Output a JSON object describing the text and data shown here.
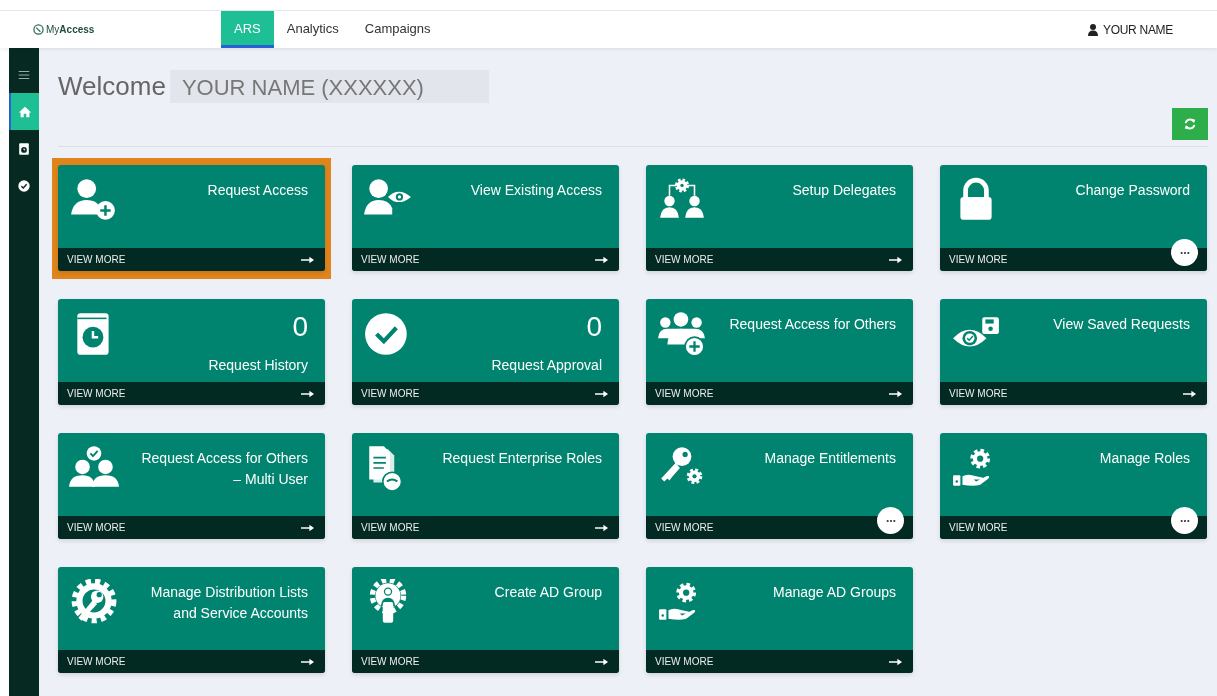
{
  "header": {
    "logo": "My**Access**",
    "tabs": [
      {
        "label": "ARS",
        "selected": true
      },
      {
        "label": "Analytics",
        "selected": false
      },
      {
        "label": "Campaigns",
        "selected": false
      }
    ],
    "user": "YOUR NAME"
  },
  "sidebar": {
    "items": [
      {
        "kind": "menu",
        "selected": false
      },
      {
        "kind": "home",
        "selected": true
      },
      {
        "kind": "history",
        "selected": false
      },
      {
        "kind": "check",
        "selected": false
      }
    ]
  },
  "welcome": {
    "label": "Welcome",
    "name": "YOUR NAME (XXXXXX)"
  },
  "cards": [
    {
      "title": "Request Access",
      "kind": "user-plus",
      "footer": {
        "label": "VIEW MORE",
        "kind": "arrow"
      },
      "highlighted": true
    },
    {
      "title": "View Existing Access",
      "kind": "user-eye",
      "footer": {
        "label": "VIEW MORE",
        "kind": "arrow"
      },
      "highlighted": false
    },
    {
      "title": "Setup Delegates",
      "kind": "delegates",
      "footer": {
        "label": "VIEW MORE",
        "kind": "arrow"
      },
      "highlighted": false
    },
    {
      "title": "Change Password",
      "kind": "lock",
      "footer": {
        "label": "VIEW MORE",
        "kind": "more"
      },
      "highlighted": false
    },
    {
      "title": "Request History",
      "count": "0",
      "kind": "history",
      "footer": {
        "label": "VIEW MORE",
        "kind": "arrow"
      },
      "highlighted": false
    },
    {
      "title": "Request Approval",
      "count": "0",
      "kind": "check",
      "footer": {
        "label": "VIEW MORE",
        "kind": "arrow"
      },
      "highlighted": false
    },
    {
      "title": "Request Access for Others",
      "kind": "users-plus",
      "footer": {
        "label": "VIEW MORE",
        "kind": "arrow"
      },
      "highlighted": false
    },
    {
      "title": "View Saved Requests",
      "kind": "eye-save",
      "footer": {
        "label": "VIEW MORE",
        "kind": "arrow"
      },
      "highlighted": false
    },
    {
      "title": "Request Access for Others\n– Multi User",
      "kind": "users-check",
      "footer": {
        "label": "VIEW MORE",
        "kind": "arrow"
      },
      "highlighted": false
    },
    {
      "title": "Request Enterprise Roles",
      "kind": "document",
      "footer": {
        "label": "VIEW MORE",
        "kind": "arrow"
      },
      "highlighted": false
    },
    {
      "title": "Manage Entitlements",
      "kind": "key-gear",
      "footer": {
        "label": "VIEW MORE",
        "kind": "more"
      },
      "highlighted": false
    },
    {
      "title": "Manage Roles",
      "kind": "hand-gear",
      "footer": {
        "label": "VIEW MORE",
        "kind": "more"
      },
      "highlighted": false
    },
    {
      "title": "Manage Distribution Lists\nand Service Accounts",
      "kind": "wrench-gear",
      "footer": {
        "label": "VIEW MORE",
        "kind": "arrow"
      },
      "highlighted": false
    },
    {
      "title": "Create AD Group",
      "kind": "person-gear",
      "footer": {
        "label": "VIEW MORE",
        "kind": "arrow"
      },
      "highlighted": false
    },
    {
      "title": "Manage AD Groups",
      "kind": "hand-gear",
      "footer": {
        "label": "VIEW MORE",
        "kind": "arrow"
      },
      "highlighted": false
    }
  ]
}
